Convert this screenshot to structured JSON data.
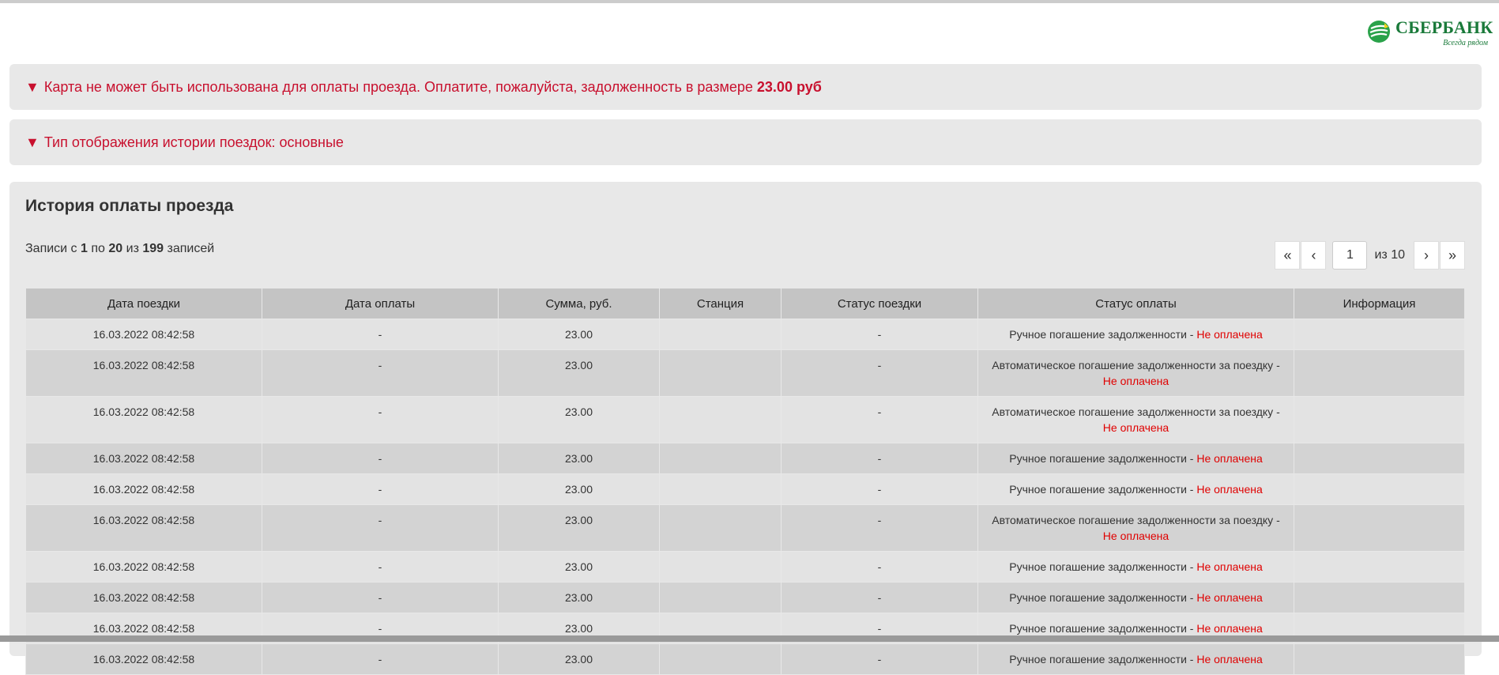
{
  "brand": {
    "name": "СБЕРБАНК",
    "slogan": "Всегда рядом",
    "color": "#1a7a3a"
  },
  "alerts": {
    "debt": {
      "icon": "triangle-down-icon",
      "text": "Карта не может быть использована для оплаты проезда. Оплатите, пожалуйста, задолженность в размере",
      "amount": "23.00 руб"
    },
    "display_mode": {
      "icon": "triangle-down-icon",
      "text": "Тип отображения истории поездок: основные"
    },
    "color": "#c8102e"
  },
  "history": {
    "title": "История оплаты проезда",
    "records": {
      "prefix": "Записи с",
      "from": "1",
      "to_word": "по",
      "to": "20",
      "of_word": "из",
      "total": "199",
      "suffix": "записей"
    },
    "pager": {
      "first": "«",
      "prev": "‹",
      "page": "1",
      "of_label": "из 10",
      "next": "›",
      "last": "»"
    },
    "columns": [
      "Дата поездки",
      "Дата оплаты",
      "Сумма, руб.",
      "Станция",
      "Статус поездки",
      "Статус оплаты",
      "Информация"
    ],
    "rows": [
      {
        "trip_date": "16.03.2022 08:42:58",
        "pay_date": "-",
        "amount": "23.00",
        "station": "",
        "trip_status": "-",
        "pay_status": "Ручное погашение задолженности -",
        "pay_result": "Не оплачена",
        "info": ""
      },
      {
        "trip_date": "16.03.2022 08:42:58",
        "pay_date": "-",
        "amount": "23.00",
        "station": "",
        "trip_status": "-",
        "pay_status": "Автоматическое погашение задолженности за поездку -",
        "pay_result": "Не оплачена",
        "info": ""
      },
      {
        "trip_date": "16.03.2022 08:42:58",
        "pay_date": "-",
        "amount": "23.00",
        "station": "",
        "trip_status": "-",
        "pay_status": "Автоматическое погашение задолженности за поездку -",
        "pay_result": "Не оплачена",
        "info": ""
      },
      {
        "trip_date": "16.03.2022 08:42:58",
        "pay_date": "-",
        "amount": "23.00",
        "station": "",
        "trip_status": "-",
        "pay_status": "Ручное погашение задолженности -",
        "pay_result": "Не оплачена",
        "info": ""
      },
      {
        "trip_date": "16.03.2022 08:42:58",
        "pay_date": "-",
        "amount": "23.00",
        "station": "",
        "trip_status": "-",
        "pay_status": "Ручное погашение задолженности -",
        "pay_result": "Не оплачена",
        "info": ""
      },
      {
        "trip_date": "16.03.2022 08:42:58",
        "pay_date": "-",
        "amount": "23.00",
        "station": "",
        "trip_status": "-",
        "pay_status": "Автоматическое погашение задолженности за поездку -",
        "pay_result": "Не оплачена",
        "info": ""
      },
      {
        "trip_date": "16.03.2022 08:42:58",
        "pay_date": "-",
        "amount": "23.00",
        "station": "",
        "trip_status": "-",
        "pay_status": "Ручное погашение задолженности -",
        "pay_result": "Не оплачена",
        "info": ""
      },
      {
        "trip_date": "16.03.2022 08:42:58",
        "pay_date": "-",
        "amount": "23.00",
        "station": "",
        "trip_status": "-",
        "pay_status": "Ручное погашение задолженности -",
        "pay_result": "Не оплачена",
        "info": ""
      },
      {
        "trip_date": "16.03.2022 08:42:58",
        "pay_date": "-",
        "amount": "23.00",
        "station": "",
        "trip_status": "-",
        "pay_status": "Ручное погашение задолженности -",
        "pay_result": "Не оплачена",
        "info": ""
      },
      {
        "trip_date": "16.03.2022 08:42:58",
        "pay_date": "-",
        "amount": "23.00",
        "station": "",
        "trip_status": "-",
        "pay_status": "Ручное погашение задолженности -",
        "pay_result": "Не оплачена",
        "info": ""
      }
    ],
    "unpaid_color": "#e00000"
  }
}
